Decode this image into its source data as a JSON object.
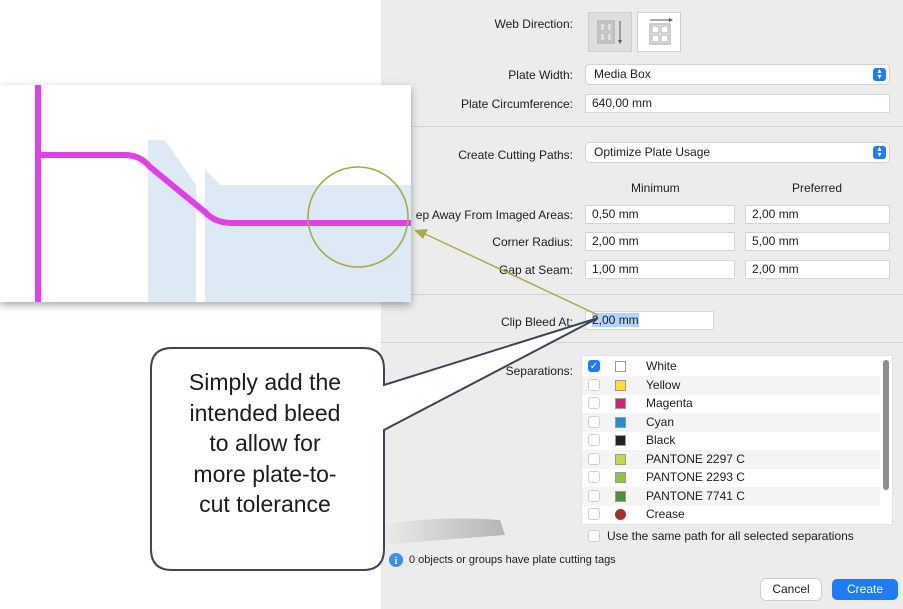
{
  "dialog": {
    "web_direction_label": "Web Direction:",
    "plate_width_label": "Plate Width:",
    "plate_width_value": "Media Box",
    "plate_circumference_label": "Plate Circumference:",
    "plate_circumference_value": "640,00 mm",
    "create_cutting_paths_label": "Create Cutting Paths:",
    "create_cutting_paths_value": "Optimize Plate Usage",
    "col_minimum": "Minimum",
    "col_preferred": "Preferred",
    "keep_away_label": "ep Away From Imaged Areas:",
    "keep_away_min": "0,50 mm",
    "keep_away_pref": "2,00 mm",
    "corner_radius_label": "Corner Radius:",
    "corner_radius_min": "2,00 mm",
    "corner_radius_pref": "5,00 mm",
    "gap_at_seam_label": "Gap at Seam:",
    "gap_at_seam_min": "1,00 mm",
    "gap_at_seam_pref": "2,00 mm",
    "clip_bleed_label": "Clip Bleed At:",
    "clip_bleed_value": "2,00 mm",
    "separations_label": "Separations:",
    "separations": [
      {
        "name": "White",
        "checked": true,
        "color": "#ffffff",
        "shape": "square"
      },
      {
        "name": "Yellow",
        "checked": false,
        "color": "#ffe11a",
        "shape": "square"
      },
      {
        "name": "Magenta",
        "checked": false,
        "color": "#d4246e",
        "shape": "square"
      },
      {
        "name": "Cyan",
        "checked": false,
        "color": "#1b8fd6",
        "shape": "square"
      },
      {
        "name": "Black",
        "checked": false,
        "color": "#222222",
        "shape": "square"
      },
      {
        "name": "PANTONE 2297 C",
        "checked": false,
        "color": "#c2d846",
        "shape": "square"
      },
      {
        "name": "PANTONE 2293 C",
        "checked": false,
        "color": "#8cc63f",
        "shape": "square"
      },
      {
        "name": "PANTONE 7741 C",
        "checked": false,
        "color": "#4f8f3a",
        "shape": "square"
      },
      {
        "name": "Crease",
        "checked": false,
        "color": "#a3302a",
        "shape": "dot"
      }
    ],
    "same_path_label": "Use the same path for all selected separations",
    "info_text": "0 objects or groups have plate cutting tags",
    "cancel_label": "Cancel",
    "create_label": "Create"
  },
  "callout": {
    "lines": [
      "Simply add the",
      "intended bleed",
      "to allow for",
      "more plate-to-",
      "cut tolerance"
    ]
  },
  "colors": {
    "cut_path": "#e040e8",
    "imaged_area": "#dde9f5",
    "highlight_circle": "#a9a94a",
    "accent": "#1f7cf4"
  }
}
